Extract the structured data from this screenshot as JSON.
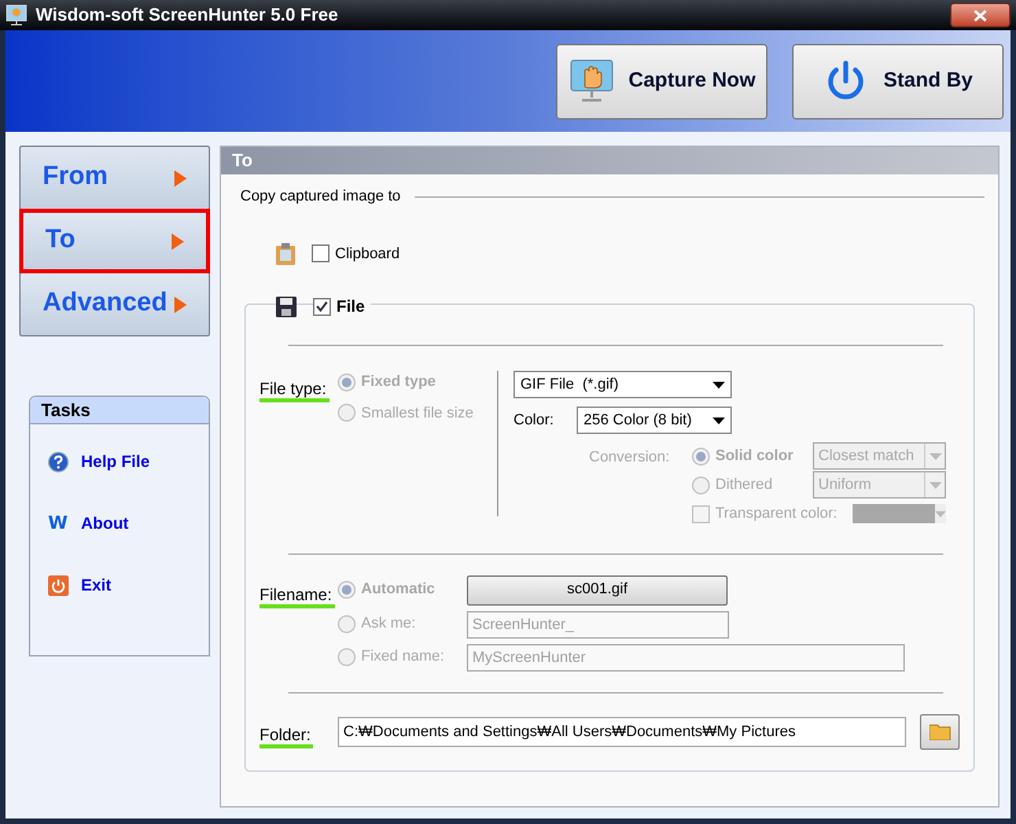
{
  "window": {
    "title": "Wisdom-soft ScreenHunter 5.0 Free"
  },
  "toolbar": [
    {
      "kind": "capture",
      "label": "Capture Now"
    },
    {
      "kind": "standby",
      "label": "Stand By"
    }
  ],
  "nav": [
    {
      "label": "From",
      "selected": false
    },
    {
      "label": "To",
      "selected": true
    },
    {
      "label": "Advanced",
      "selected": false
    }
  ],
  "tasks": {
    "title": "Tasks",
    "items": [
      {
        "kind": "help",
        "label": "Help File"
      },
      {
        "kind": "about",
        "glyph": "W",
        "label": "About"
      },
      {
        "kind": "exit",
        "label": "Exit"
      }
    ]
  },
  "panel": {
    "title": "To",
    "section": "Copy captured image to",
    "clipboard": {
      "label": "Clipboard",
      "checked": false
    },
    "file": {
      "label": "File",
      "checked": true
    },
    "file_type": {
      "label": "File type:",
      "options": [
        {
          "label": "Fixed type",
          "selected": true,
          "disabled": true
        },
        {
          "label": "Smallest file size",
          "selected": false,
          "disabled": true
        }
      ],
      "format": "GIF File  (*.gif)",
      "color_label": "Color:",
      "color_depth": "256 Color (8 bit)",
      "conversion_label": "Conversion:",
      "conversion": [
        {
          "label": "Solid color",
          "selected": true,
          "disabled": true,
          "value": "Closest match"
        },
        {
          "label": "Dithered",
          "selected": false,
          "disabled": true,
          "value": "Uniform"
        }
      ],
      "transparent": {
        "label": "Transparent color:",
        "checked": false,
        "disabled": true
      }
    },
    "filename": {
      "label": "Filename:",
      "options": [
        {
          "kind": "button",
          "label": "Automatic",
          "selected": true,
          "disabled": true,
          "value": "sc001.gif"
        },
        {
          "kind": "field",
          "label": "Ask me:",
          "selected": false,
          "disabled": true,
          "value": "ScreenHunter_"
        },
        {
          "kind": "field",
          "label": "Fixed name:",
          "selected": false,
          "disabled": true,
          "value": "MyScreenHunter"
        }
      ]
    },
    "folder": {
      "label": "Folder:",
      "value": "C:₩Documents and Settings₩All Users₩Documents₩My Pictures"
    }
  }
}
